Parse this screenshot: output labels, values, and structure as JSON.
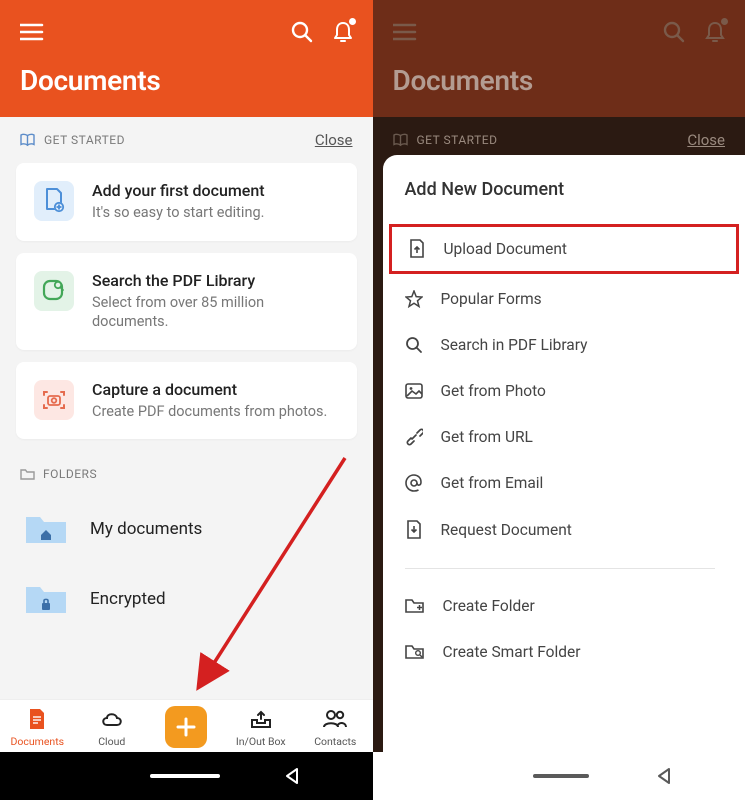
{
  "header": {
    "title": "Documents"
  },
  "getStarted": {
    "label": "GET STARTED",
    "close": "Close"
  },
  "cards": [
    {
      "title": "Add your first document",
      "sub": "It's so easy to start editing."
    },
    {
      "title": "Search the PDF Library",
      "sub": "Select from over 85 million documents."
    },
    {
      "title": "Capture a document",
      "sub": "Create PDF documents from photos."
    }
  ],
  "foldersLabel": "FOLDERS",
  "folders": [
    {
      "label": "My documents"
    },
    {
      "label": "Encrypted"
    }
  ],
  "nav": {
    "documents": "Documents",
    "cloud": "Cloud",
    "inout": "In/Out Box",
    "contacts": "Contacts"
  },
  "sheet": {
    "title": "Add New Document",
    "upload": "Upload Document",
    "popular": "Popular Forms",
    "searchLib": "Search in PDF Library",
    "photo": "Get from Photo",
    "url": "Get from URL",
    "email": "Get from Email",
    "request": "Request Document",
    "createFolder": "Create Folder",
    "createSmart": "Create Smart Folder"
  }
}
